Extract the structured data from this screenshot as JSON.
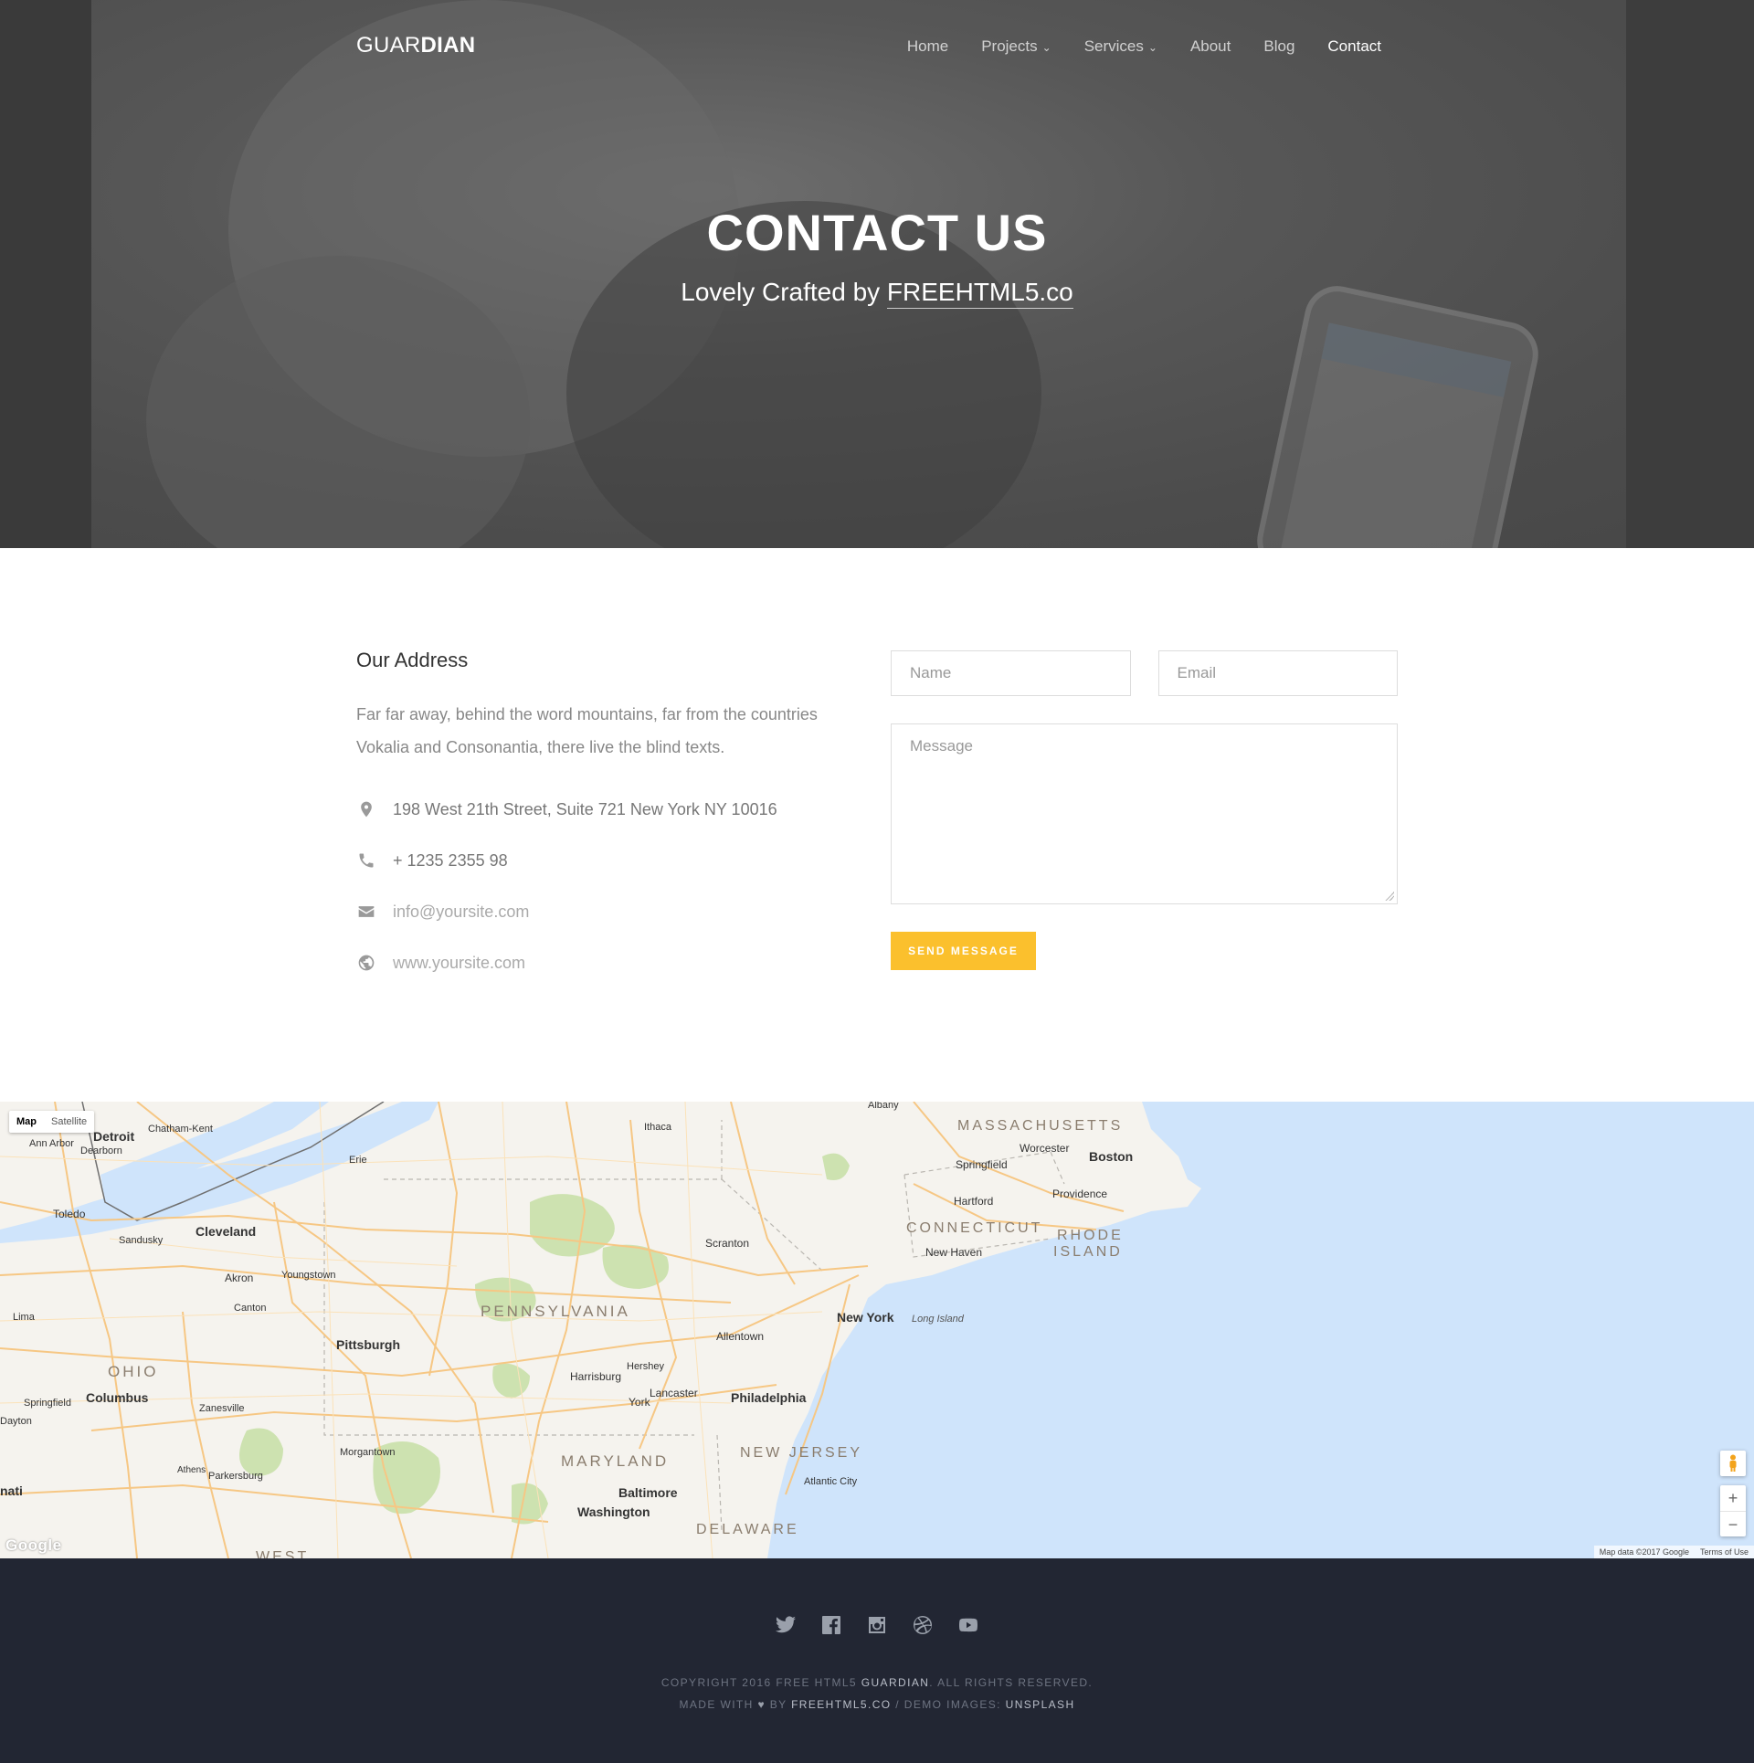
{
  "nav": {
    "logo_light": "GUAR",
    "logo_bold": "DIAN",
    "items": [
      {
        "label": "Home"
      },
      {
        "label": "Projects",
        "caret": "⌄"
      },
      {
        "label": "Services",
        "caret": "⌄"
      },
      {
        "label": "About"
      },
      {
        "label": "Blog"
      },
      {
        "label": "Contact"
      }
    ]
  },
  "hero": {
    "title": "CONTACT US",
    "subtitle_prefix": "Lovely Crafted by ",
    "subtitle_link": "FREEHTML5.co"
  },
  "address": {
    "heading": "Our Address",
    "description": "Far far away, behind the word mountains, far from the countries Vokalia and Consonantia, there live the blind texts.",
    "items": [
      {
        "icon": "map-pin-icon",
        "text": "198 West 21th Street, Suite 721 New York NY 10016"
      },
      {
        "icon": "phone-icon",
        "text": "+ 1235 2355 98"
      },
      {
        "icon": "envelope-icon",
        "text": "info@yoursite.com"
      },
      {
        "icon": "globe-icon",
        "text": "www.yoursite.com"
      }
    ]
  },
  "form": {
    "name_placeholder": "Name",
    "email_placeholder": "Email",
    "message_placeholder": "Message",
    "submit_label": "SEND MESSAGE"
  },
  "map": {
    "type_map": "Map",
    "type_satellite": "Satellite",
    "google": "Google",
    "map_data": "Map data ©2017 Google",
    "terms": "Terms of Use",
    "zoom_in": "+",
    "zoom_out": "−",
    "labels": {
      "massachusetts": "MASSACHUSETTS",
      "boston": "Boston",
      "worcester": "Worcester",
      "springfield_ma": "Springfield",
      "providence": "Providence",
      "hartford": "Hartford",
      "connecticut": "CONNECTICUT",
      "rhode_island_1": "RHODE",
      "rhode_island_2": "ISLAND",
      "new_haven": "New Haven",
      "new_york": "New York",
      "long_island": "Long Island",
      "albany": "Albany",
      "ithaca": "Ithaca",
      "scranton": "Scranton",
      "allentown": "Allentown",
      "pennsylvania": "PENNSYLVANIA",
      "harrisburg": "Harrisburg",
      "hershey": "Hershey",
      "lancaster": "Lancaster",
      "york": "York",
      "philadelphia": "Philadelphia",
      "new_jersey": "NEW JERSEY",
      "atlantic_city": "Atlantic City",
      "maryland": "MARYLAND",
      "baltimore": "Baltimore",
      "washington": "Washington",
      "delaware": "DELAWARE",
      "pittsburgh": "Pittsburgh",
      "morgantown": "Morgantown",
      "ohio": "OHIO",
      "columbus": "Columbus",
      "zanesville": "Zanesville",
      "springfield_oh": "Springfield",
      "dayton": "Dayton",
      "athens": "Athens",
      "parkersburg": "Parkersburg",
      "cleveland": "Cleveland",
      "akron": "Akron",
      "youngstown": "Youngstown",
      "canton": "Canton",
      "sandusky": "Sandusky",
      "toledo": "Toledo",
      "lima": "Lima",
      "detroit": "Detroit",
      "dearborn": "Dearborn",
      "ann_arbor": "Ann Arbor",
      "chatham_kent": "Chatham-Kent",
      "erie": "Erie",
      "west": "WEST",
      "nati": "nati"
    }
  },
  "footer": {
    "social": [
      "twitter-icon",
      "facebook-icon",
      "instagram-icon",
      "dribbble-icon",
      "youtube-icon"
    ],
    "copyright_prefix": "COPYRIGHT 2016 FREE HTML5 ",
    "copyright_brand": "GUARDIAN",
    "copyright_suffix": ". ALL RIGHTS RESERVED.",
    "made_with": "MADE WITH",
    "heart": "♥",
    "by": " BY ",
    "by_link": "FREEHTML5.CO",
    "demo_images": " / DEMO IMAGES: ",
    "demo_link": "UNSPLASH"
  }
}
